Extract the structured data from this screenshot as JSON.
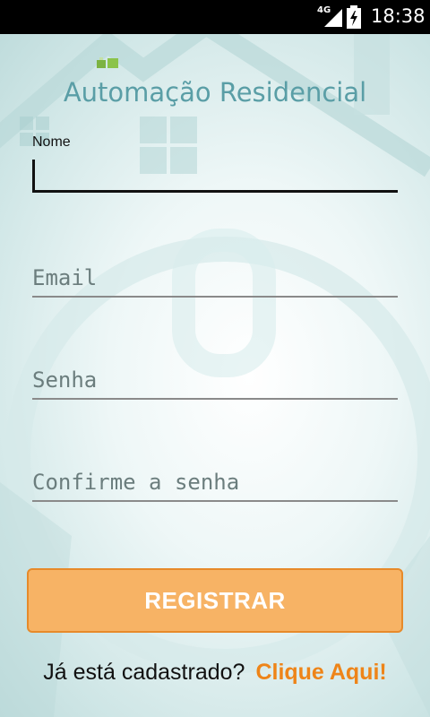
{
  "status_bar": {
    "network": "4G",
    "time": "18:38"
  },
  "app": {
    "title": "Automação Residencial"
  },
  "form": {
    "name_label": "Nome",
    "name_value": "",
    "email_placeholder": "Email",
    "password_placeholder": "Senha",
    "confirm_placeholder": "Confirme a senha",
    "register_button": "REGISTRAR"
  },
  "footer": {
    "question": "Já está cadastrado?",
    "link": "Clique Aqui!"
  },
  "colors": {
    "accent": "#f7b365",
    "accent_border": "#e78a2a",
    "link": "#ee8418",
    "title": "#5a9ea6"
  }
}
